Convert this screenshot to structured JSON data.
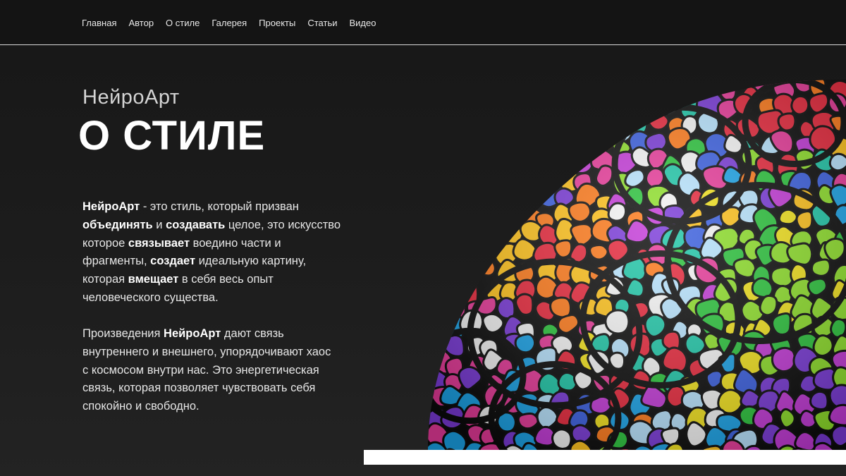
{
  "nav": {
    "items": [
      {
        "label": "Главная"
      },
      {
        "label": "Автор"
      },
      {
        "label": "О стиле"
      },
      {
        "label": "Галерея"
      },
      {
        "label": "Проекты"
      },
      {
        "label": "Статьи"
      },
      {
        "label": "Видео"
      }
    ]
  },
  "hero": {
    "subtitle": "НейроАрт",
    "title": "О СТИЛЕ"
  },
  "intro": {
    "lines": [
      [
        {
          "t": "НейроАрт",
          "b": true
        },
        {
          "t": " - это стиль, который призван",
          "b": false
        }
      ],
      [
        {
          "t": "объединять",
          "b": true
        },
        {
          "t": " и ",
          "b": false
        },
        {
          "t": "создавать",
          "b": true
        },
        {
          "t": " целое, это искусство",
          "b": false
        }
      ],
      [
        {
          "t": "которое ",
          "b": false
        },
        {
          "t": "связывает",
          "b": true
        },
        {
          "t": " воедино части и",
          "b": false
        }
      ],
      [
        {
          "t": "фрагменты, ",
          "b": false
        },
        {
          "t": "создает",
          "b": true
        },
        {
          "t": " идеальную картину,",
          "b": false
        }
      ],
      [
        {
          "t": "которая ",
          "b": false
        },
        {
          "t": "вмещает",
          "b": true
        },
        {
          "t": " в себя весь опыт",
          "b": false
        }
      ],
      [
        {
          "t": "человеческого существа.",
          "b": false
        }
      ]
    ]
  },
  "works": {
    "lines": [
      [
        {
          "t": "Произведения ",
          "b": false
        },
        {
          "t": "НейроАрт",
          "b": true
        },
        {
          "t": " дают связь",
          "b": false
        }
      ],
      [
        {
          "t": "внутреннего и внешнего, упорядочивают хаос",
          "b": false
        }
      ],
      [
        {
          "t": "с космосом внутри нас. Это энергетическая",
          "b": false
        }
      ],
      [
        {
          "t": "связь, которая позволяет чувствовать себя",
          "b": false
        }
      ],
      [
        {
          "t": "спокойно и свободно.",
          "b": false
        }
      ]
    ]
  },
  "artwork": {
    "icon": "stained-glass-artwork",
    "palette": [
      "#e8283c",
      "#ff7a1a",
      "#ffc21a",
      "#f2e21c",
      "#8ee02a",
      "#2bc43c",
      "#1fc7a8",
      "#1aa3e8",
      "#3a5fe0",
      "#7a3ad8",
      "#c43ad8",
      "#e83a9a",
      "#f4f4f4",
      "#b8e4ff"
    ]
  }
}
